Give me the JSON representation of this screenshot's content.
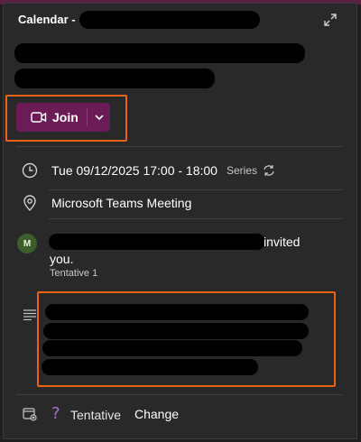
{
  "header": {
    "title": "Calendar -",
    "expand_icon": "expand-icon"
  },
  "join": {
    "label": "Join",
    "video_icon": "video-camera-icon",
    "dropdown_icon": "chevron-down-icon",
    "button_color": "#6b1b56"
  },
  "details": {
    "datetime": "Tue 09/12/2025 17:00 - 18:00",
    "series_label": "Series",
    "location": "Microsoft Teams Meeting",
    "invite_suffix": "invited",
    "invite_line2": "you.",
    "tentative_count": "Tentative 1",
    "avatar_initial": "M"
  },
  "footer": {
    "response_status": "Tentative",
    "change_label": "Change",
    "status_icon": "question-mark-icon",
    "calendar_icon": "calendar-status-icon"
  },
  "colors": {
    "accent": "#e8631a",
    "panel": "#292929",
    "tentative": "#a46fd3"
  }
}
